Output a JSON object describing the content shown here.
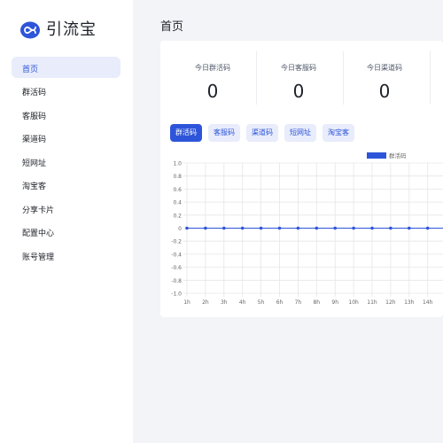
{
  "app": {
    "name": "引流宝",
    "logo_icon": "infinity-icon",
    "accent": "#2e55d9"
  },
  "sidebar": {
    "items": [
      {
        "label": "首页",
        "active": true
      },
      {
        "label": "群活码"
      },
      {
        "label": "客服码"
      },
      {
        "label": "渠道码"
      },
      {
        "label": "短网址"
      },
      {
        "label": "淘宝客"
      },
      {
        "label": "分享卡片"
      },
      {
        "label": "配置中心"
      },
      {
        "label": "账号管理"
      }
    ]
  },
  "page": {
    "title": "首页"
  },
  "stats": [
    {
      "label": "今日群活码",
      "value": "0"
    },
    {
      "label": "今日客服码",
      "value": "0"
    },
    {
      "label": "今日渠道码",
      "value": "0"
    }
  ],
  "tabs": [
    {
      "label": "群活码",
      "active": true
    },
    {
      "label": "客服码"
    },
    {
      "label": "渠道码"
    },
    {
      "label": "短网址"
    },
    {
      "label": "淘宝客"
    }
  ],
  "chart_data": {
    "type": "line",
    "categories": [
      "1h",
      "2h",
      "3h",
      "4h",
      "5h",
      "6h",
      "7h",
      "8h",
      "9h",
      "10h",
      "11h",
      "12h",
      "13h",
      "14h"
    ],
    "series": [
      {
        "name": "群活码",
        "values": [
          0,
          0,
          0,
          0,
          0,
          0,
          0,
          0,
          0,
          0,
          0,
          0,
          0,
          0
        ],
        "color": "#2e55d9"
      }
    ],
    "yticks": [
      "1.0",
      "0.8",
      "0.6",
      "0.4",
      "0.2",
      "0",
      "-0.2",
      "-0.4",
      "-0.6",
      "-0.8",
      "-1.0"
    ],
    "ylim": [
      -1.0,
      1.0
    ],
    "grid": true,
    "legend": "top-right"
  }
}
